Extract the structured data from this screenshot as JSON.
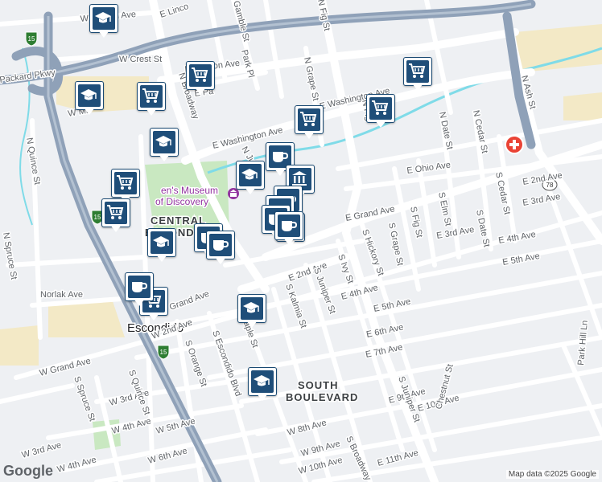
{
  "map": {
    "attribution": "Map data ©2025 Google",
    "logo": "Google",
    "colors": {
      "land": "#eef0f3",
      "road": "#ffffff",
      "highway": "#8fa1b8",
      "park": "#c9e8c1",
      "industrial": "#f3e9c6",
      "water": "#7fdbe8",
      "marker": "#1f4e79",
      "hospital": "#ea4335"
    }
  },
  "areas": {
    "central": [
      "CENTRAL",
      "ESCONDIDO"
    ],
    "south": [
      "SOUTH",
      "BOULEVARD"
    ],
    "escondido": "Escondido"
  },
  "poi": {
    "museum": [
      "en's Museum",
      "of Discovery"
    ]
  },
  "shields": {
    "i15_north": "15",
    "i15_mid": "15",
    "i15_south": "15",
    "sr78": "78"
  },
  "streets": {
    "w_lincoln": "W Lincoln Ave",
    "e_linc": "E Linco",
    "packard": "Packard Pkwy",
    "w_crest": "W Crest St",
    "e_mission": "E Mission Ave",
    "park_pl": "Park Pl",
    "gamble": "Gamble St",
    "n_grape_top": "N Grape St",
    "n_fig_top": "N Fig St",
    "e_washington_1": "E Washington Ave",
    "e_washington_2": "E Washington Ave",
    "n_fig": "N Fig",
    "w_mi": "W Mi",
    "e_pa": "E Pa",
    "n_broadway": "N Broadway",
    "n_juniper": "N Junip",
    "n_quince": "N Quince St",
    "n_spruce": "N Spruce St",
    "norlak": "Norlak Ave",
    "w_grand": "W Grand Ave",
    "grand_ave": "Grand Ave",
    "w_2nd": "W 2nd Ave",
    "e_grand": "E Grand Ave",
    "e_ohio": "E Ohio Ave",
    "e_2nd_right": "E 2nd Ave",
    "e_3rd_right": "E 3rd Ave",
    "e_3rd": "E 3rd Ave",
    "e_4th": "E 4th Ave",
    "e_4th_mid": "E 4th Ave",
    "e_5th": "E 5th Ave",
    "e_5th_mid": "E 5th Ave",
    "e_6th": "E 6th Ave",
    "e_7th": "E 7th Ave",
    "e_2nd": "E 2nd Ave",
    "e_9th": "E 9th Ave",
    "e_10th": "E 10th Ave",
    "e_11th": "E 11th Ave",
    "w_9th": "W 9th Ave",
    "w_10th": "W 10th Ave",
    "w_8th": "W 8th Ave",
    "w_6th": "W 6th Ave",
    "w_5th": "W 5th Ave",
    "w_4th": "W 4th Ave",
    "w_4th_b": "W 4th Ave",
    "w_3rd": "W 3rd Ave",
    "w_3rd_b": "W 3rd Ave",
    "s_spruce": "S Spruce St",
    "s_quince": "S Quince St",
    "s_orange": "S Orange St",
    "s_escondido": "S Escondido Blvd",
    "s_maple": "S Maple St",
    "s_kalmia": "S Kalmia St",
    "s_juniper": "S Juniper St",
    "s_juniper_b": "S Juniper St",
    "s_ivy": "S Ivy St",
    "s_hickory": "S Hickory St",
    "s_grape": "S Grape St",
    "s_fig": "S Fig St",
    "s_elm": "S Elm St",
    "s_date": "S Date St",
    "s_cedar": "S Cedar St",
    "n_date": "N Date St",
    "n_cedar": "N Cedar St",
    "n_ash": "N Ash St",
    "chestnut": "Chestnut St",
    "park_hill": "Park Hill Ln",
    "s_broadway": "S Broadway",
    "s_ash": "S Ash St",
    "s_date_lower": "S Date St"
  },
  "markers": [
    {
      "type": "school",
      "icon": "graduation-cap-icon"
    },
    {
      "type": "school",
      "icon": "graduation-cap-icon"
    },
    {
      "type": "shopping",
      "icon": "shopping-cart-icon"
    },
    {
      "type": "shopping",
      "icon": "shopping-cart-icon"
    },
    {
      "type": "shopping",
      "icon": "shopping-cart-icon"
    },
    {
      "type": "shopping",
      "icon": "shopping-cart-icon"
    },
    {
      "type": "shopping",
      "icon": "shopping-cart-icon"
    },
    {
      "type": "school",
      "icon": "graduation-cap-icon"
    },
    {
      "type": "school",
      "icon": "graduation-cap-icon"
    },
    {
      "type": "shopping",
      "icon": "shopping-cart-icon"
    },
    {
      "type": "shopping",
      "icon": "shopping-cart-icon"
    },
    {
      "type": "cafe",
      "icon": "coffee-cup-icon"
    },
    {
      "type": "school",
      "icon": "graduation-cap-icon"
    },
    {
      "type": "building",
      "icon": "building-icon"
    },
    {
      "type": "cafe",
      "icon": "coffee-cup-icon"
    },
    {
      "type": "cafe",
      "icon": "coffee-cup-icon"
    },
    {
      "type": "cafe",
      "icon": "coffee-cup-icon"
    },
    {
      "type": "cafe",
      "icon": "coffee-cup-icon"
    },
    {
      "type": "cafe",
      "icon": "coffee-cup-icon"
    },
    {
      "type": "cafe",
      "icon": "coffee-cup-icon"
    },
    {
      "type": "cafe",
      "icon": "coffee-cup-icon"
    },
    {
      "type": "shopping",
      "icon": "shopping-cart-icon"
    },
    {
      "type": "cafe",
      "icon": "coffee-cup-icon"
    },
    {
      "type": "school",
      "icon": "graduation-cap-icon"
    },
    {
      "type": "school",
      "icon": "graduation-cap-icon"
    }
  ]
}
